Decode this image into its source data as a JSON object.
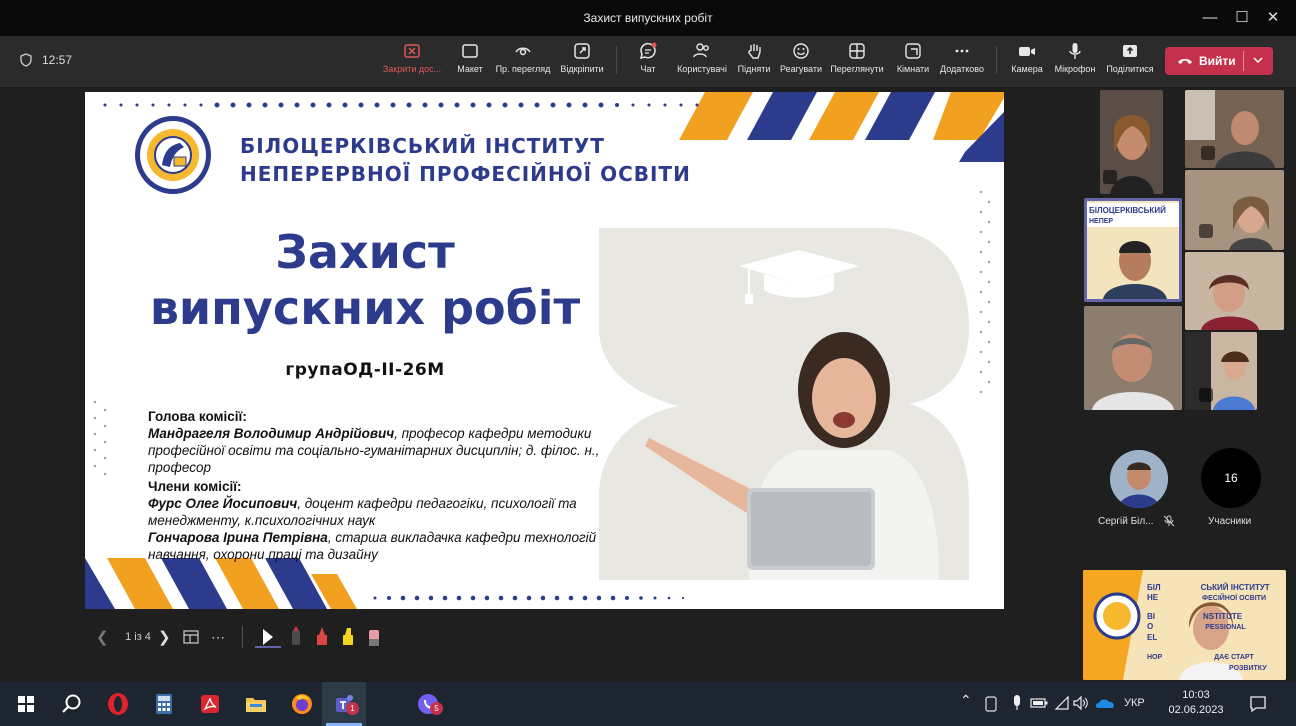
{
  "window": {
    "title": "Захист випускних робіт",
    "controls": [
      "—",
      "☐",
      "✕"
    ]
  },
  "meeting": {
    "timer": "12:57",
    "toolbar": [
      {
        "label": "Закрити дос...",
        "icon": "close-share-icon"
      },
      {
        "label": "Макет",
        "icon": "layout-icon"
      },
      {
        "label": "Пр. перегляд",
        "icon": "preview-icon"
      },
      {
        "label": "Відкріпити",
        "icon": "pop-out-icon"
      },
      {
        "label": "Чат",
        "icon": "chat-icon"
      },
      {
        "label": "Користувачі",
        "icon": "people-icon"
      },
      {
        "label": "Підняти",
        "icon": "raise-hand-icon"
      },
      {
        "label": "Реагувати",
        "icon": "react-icon"
      },
      {
        "label": "Переглянути",
        "icon": "view-icon"
      },
      {
        "label": "Кімнати",
        "icon": "rooms-icon"
      },
      {
        "label": "Додатково",
        "icon": "more-icon"
      },
      {
        "label": "Камера",
        "icon": "camera-icon"
      },
      {
        "label": "Мікрофон",
        "icon": "mic-icon"
      },
      {
        "label": "Поділитися",
        "icon": "share-icon"
      }
    ],
    "leave_label": "Вийти"
  },
  "slide": {
    "institute_line1": "БІЛОЦЕРКІВСЬКИЙ ІНСТИТУТ",
    "institute_line2": "НЕПЕРЕРВНОЇ ПРОФЕСІЙНОЇ ОСВІТИ",
    "title_line1": "Захист",
    "title_line2": "випускних робіт",
    "group": "групаОД-ІІ-26М",
    "head_label": "Голова комісії:",
    "head_name": "Мандрагеля Володимир Андрійович",
    "head_desc": ", професор кафедри методики професійної освіти та соціально-гуманітарних дисциплін; д. філос. н., професор",
    "members_label": "Члени комісії:",
    "member1_name": "Фурс Олег Йосипович",
    "member1_desc": ", доцент кафедри педагогіки, психології та менеджменту, к.психологічних наук",
    "member2_name": "Гончарова Ірина Петрівна",
    "member2_desc": ", старша викладачка кафедри технологій навчання, охорони праці та дизайну"
  },
  "slide_controls": {
    "page": "1 із 4"
  },
  "participants": {
    "featured_name": "Сергій Біл...",
    "count": "16",
    "count_label": "Учасники",
    "self_view_text": {
      "l1": "БІЛ",
      "l1b": "СЬКИЙ ІНСТИТУТ",
      "l2": "НЕ",
      "l2b": "ФЕСІЙНОЇ ОСВІТИ",
      "l3": "BI",
      "l3b": "NSTITUTE",
      "l4": "O",
      "l4b": "PESSIONAL",
      "l5": "EL",
      "l6": "НОР",
      "l6b": "ДАЄ СТАРТ",
      "l7": "РОЗВИТКУ"
    },
    "colors": {
      "active_border": "#6264a7"
    }
  },
  "taskbar": {
    "language": "УКР",
    "time": "10:03",
    "date": "02.06.2023",
    "teams_badge": "1",
    "viber_badge": "5"
  }
}
